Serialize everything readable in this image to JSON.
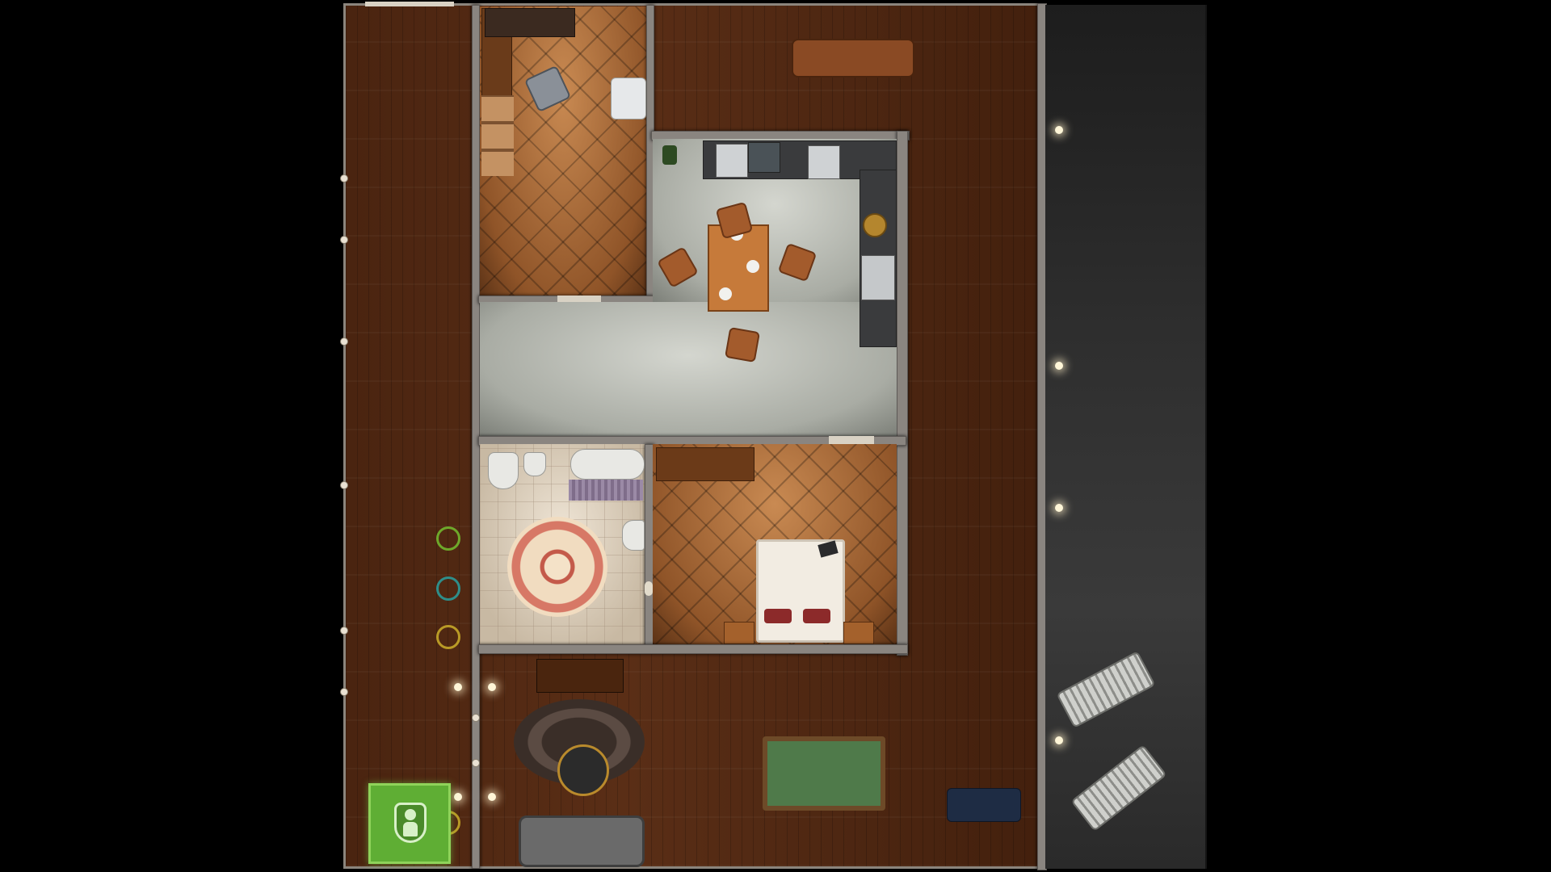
{
  "scene": {
    "title": "",
    "colors": {
      "background": "#000000",
      "deck": "#2e2e2e",
      "wall": "#8a8580",
      "marker_green": "#6ea82a",
      "marker_teal": "#2e8e8a",
      "marker_yellow": "#b99a26",
      "select": "#5fae34"
    }
  },
  "map": {
    "rooms": [
      {
        "name": "study"
      },
      {
        "name": "kitchen-dining"
      },
      {
        "name": "bathroom"
      },
      {
        "name": "bedroom"
      },
      {
        "name": "lounge"
      }
    ],
    "markers": [
      {
        "color": "#6ea82a",
        "icon": "ring-marker"
      },
      {
        "color": "#2e8e8a",
        "icon": "ring-marker"
      },
      {
        "color": "#b99a26",
        "icon": "ring-marker"
      }
    ],
    "selected_unit": {
      "icon": "person-shield-icon"
    }
  }
}
